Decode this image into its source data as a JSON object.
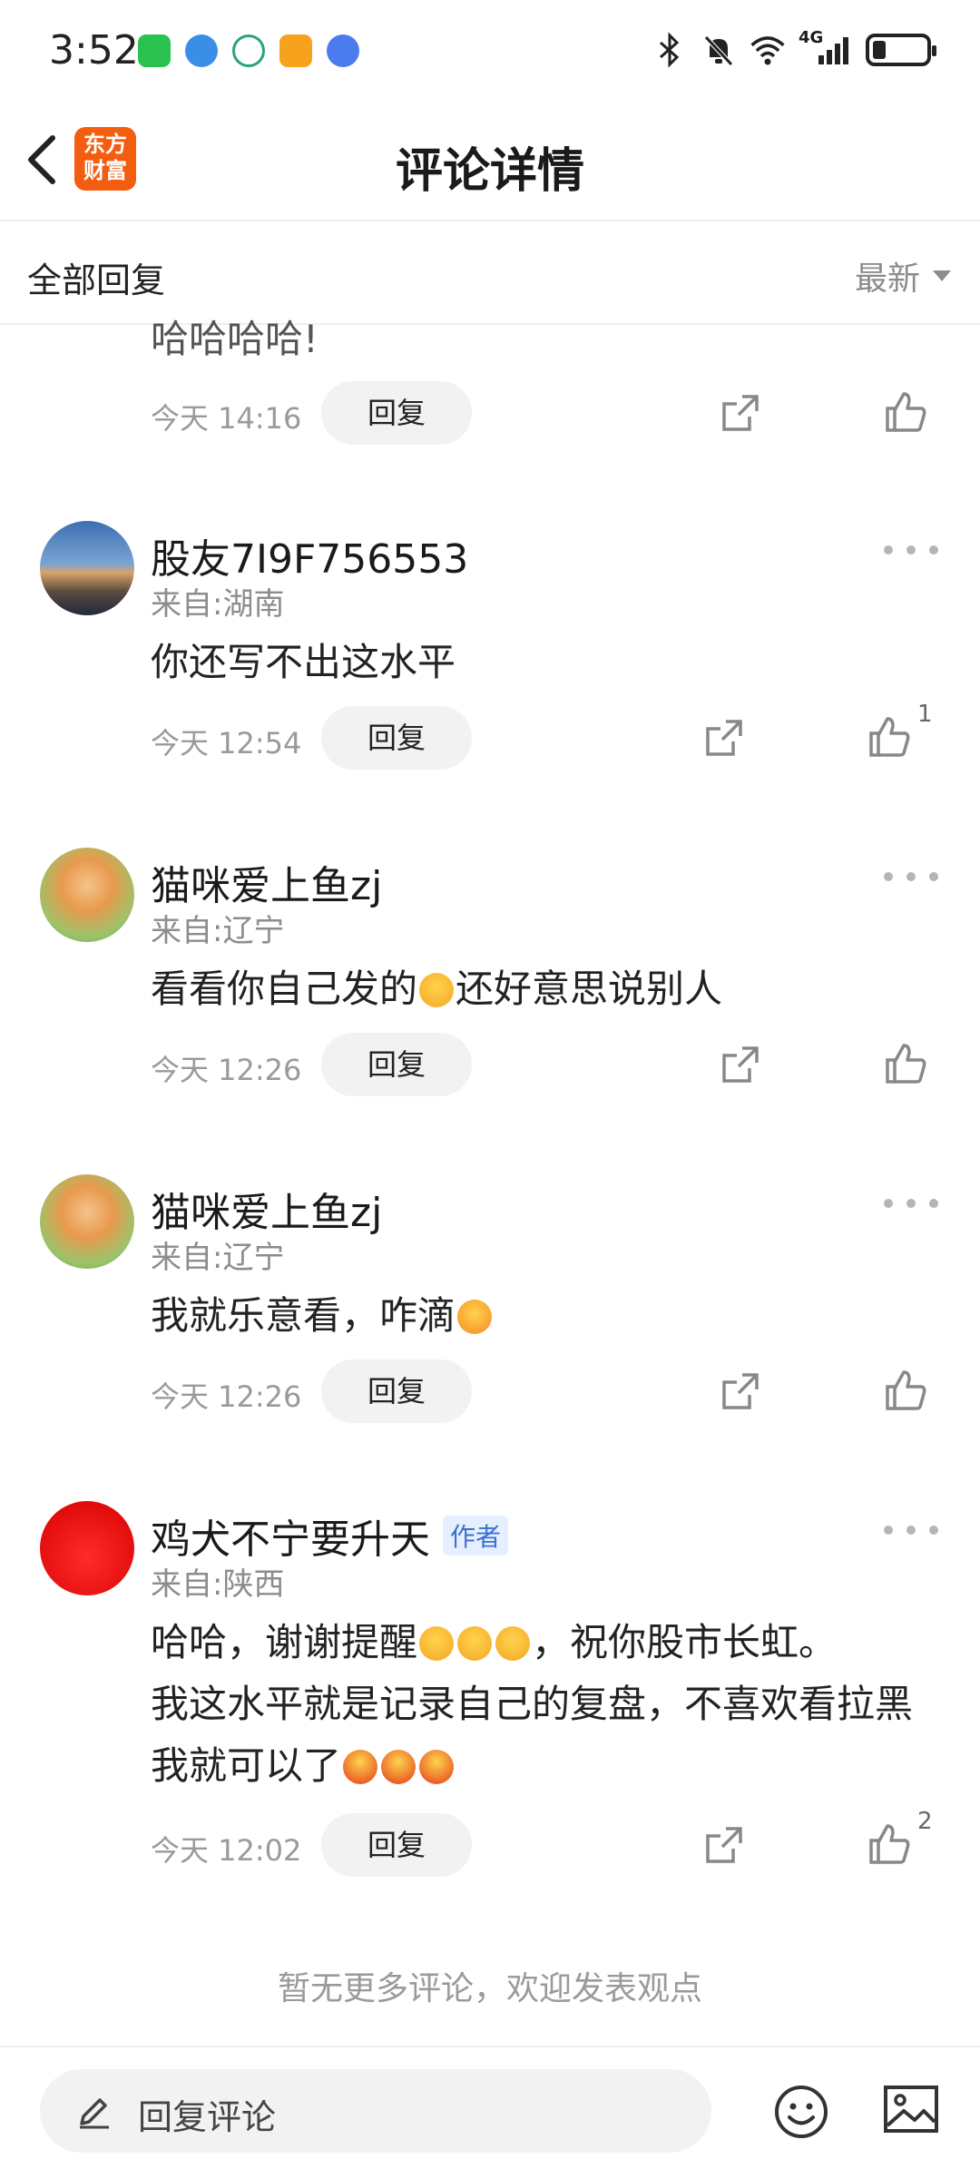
{
  "status_bar": {
    "time": "3:52",
    "network": "4G"
  },
  "nav": {
    "title": "评论详情",
    "logo_text": "东方财富"
  },
  "filter": {
    "label": "全部回复",
    "sort": "最新"
  },
  "reply_label": "回复",
  "comments": [
    {
      "text": "哈哈哈哈!",
      "time": "今天 14:16",
      "likes": ""
    },
    {
      "name": "股友7I9F756553",
      "location": "来自:湖南",
      "text": "你还写不出这水平",
      "time": "今天 12:54",
      "likes": "1"
    },
    {
      "name": "猫咪爱上鱼zj",
      "location": "来自:辽宁",
      "text_parts": [
        "看看你自己发的",
        "还好意思说别人"
      ],
      "time": "今天 12:26",
      "likes": ""
    },
    {
      "name": "猫咪爱上鱼zj",
      "location": "来自:辽宁",
      "text": "我就乐意看，咋滴",
      "time": "今天 12:26",
      "likes": ""
    },
    {
      "name": "鸡犬不宁要升天",
      "badge": "作者",
      "location": "来自:陕西",
      "text_parts": [
        "哈哈，谢谢提醒",
        "，祝你股市长虹。",
        "我这水平就是记录自己的复盘，不喜欢看拉黑我就可以了"
      ],
      "time": "今天 12:02",
      "likes": "2"
    }
  ],
  "footer_note": "暂无更多评论，欢迎发表观点",
  "bottom": {
    "placeholder": "回复评论"
  },
  "icons": {
    "back": "back-arrow-icon",
    "share": "share-icon",
    "like": "thumbs-up-icon",
    "more": "more-dots-icon",
    "emoji": "emoji-icon",
    "image": "image-icon",
    "pen": "pencil-icon"
  },
  "colors": {
    "brand": "#f45d0f",
    "author_badge": "#3a6fcf"
  }
}
